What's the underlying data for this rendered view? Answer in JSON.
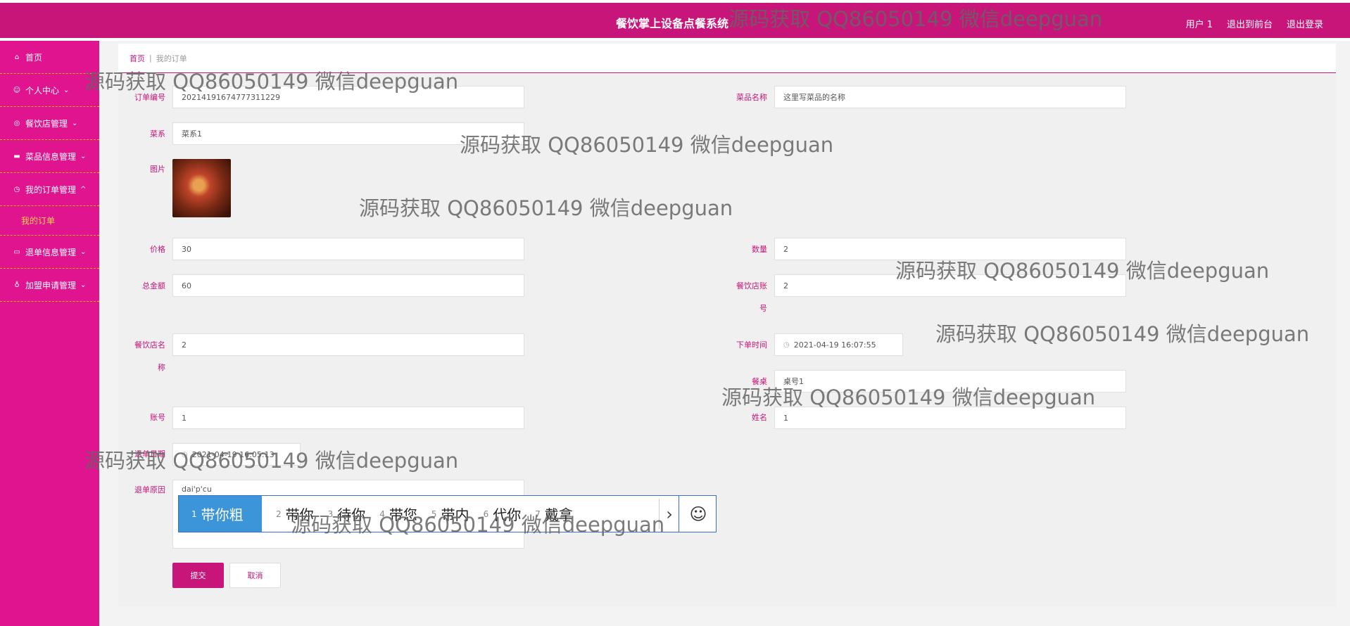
{
  "header": {
    "title": "餐饮掌上设备点餐系统",
    "user": "用户 1",
    "front_link": "退出到前台",
    "logout": "退出登录"
  },
  "sidebar": {
    "items": [
      {
        "label": "首页",
        "icon": "home-icon"
      },
      {
        "label": "个人中心",
        "icon": "user-icon"
      },
      {
        "label": "餐饮店管理",
        "icon": "store-icon"
      },
      {
        "label": "菜品信息管理",
        "icon": "dish-icon"
      },
      {
        "label": "我的订单管理",
        "icon": "order-icon"
      },
      {
        "label": "我的订单",
        "icon": ""
      },
      {
        "label": "退单信息管理",
        "icon": "refund-icon"
      },
      {
        "label": "加盟申请管理",
        "icon": "join-icon"
      }
    ]
  },
  "breadcrumb": {
    "home": "首页",
    "separator": "|",
    "current": "我的订单"
  },
  "form": {
    "order_no": {
      "label": "订单编号",
      "value": "20214191674777311229"
    },
    "dish_name": {
      "label": "菜品名称",
      "value": "这里写菜品的名称"
    },
    "cuisine": {
      "label": "菜系",
      "value": "菜系1"
    },
    "image": {
      "label": "图片"
    },
    "price": {
      "label": "价格",
      "value": "30"
    },
    "quantity": {
      "label": "数量",
      "value": "2"
    },
    "total": {
      "label": "总金额",
      "value": "60"
    },
    "store_account": {
      "label_1": "餐饮店账",
      "label_2": "号",
      "value": "2"
    },
    "store_name": {
      "label_1": "餐饮店名",
      "label_2": "称",
      "value": "2"
    },
    "order_time": {
      "label": "下单时间",
      "value": "2021-04-19 16:07:55"
    },
    "table": {
      "label": "餐桌",
      "value": "桌号1"
    },
    "account": {
      "label": "账号",
      "value": "1"
    },
    "name": {
      "label": "姓名",
      "value": "1"
    },
    "refund_date": {
      "label": "退单日期",
      "value": "2021-04-19 16:05:13"
    },
    "refund_reason": {
      "label": "退单原因",
      "value": "dai'p'cu"
    }
  },
  "ime": {
    "candidates": [
      {
        "n": "1",
        "text": "带你粗"
      },
      {
        "n": "2",
        "text": "带你"
      },
      {
        "n": "3",
        "text": "待你"
      },
      {
        "n": "4",
        "text": "带您"
      },
      {
        "n": "5",
        "text": "带内"
      },
      {
        "n": "6",
        "text": "代你"
      },
      {
        "n": "7",
        "text": "戴拿"
      }
    ],
    "emoji": "☺",
    "next": "›"
  },
  "buttons": {
    "submit": "提交",
    "cancel": "取消"
  },
  "watermark": "源码获取 QQ86050149 微信deepguan",
  "colors": {
    "primary": "#c81579",
    "sidebar": "#e0148e",
    "active_sub": "#ffd54a",
    "ime_select": "#3b95d8"
  }
}
